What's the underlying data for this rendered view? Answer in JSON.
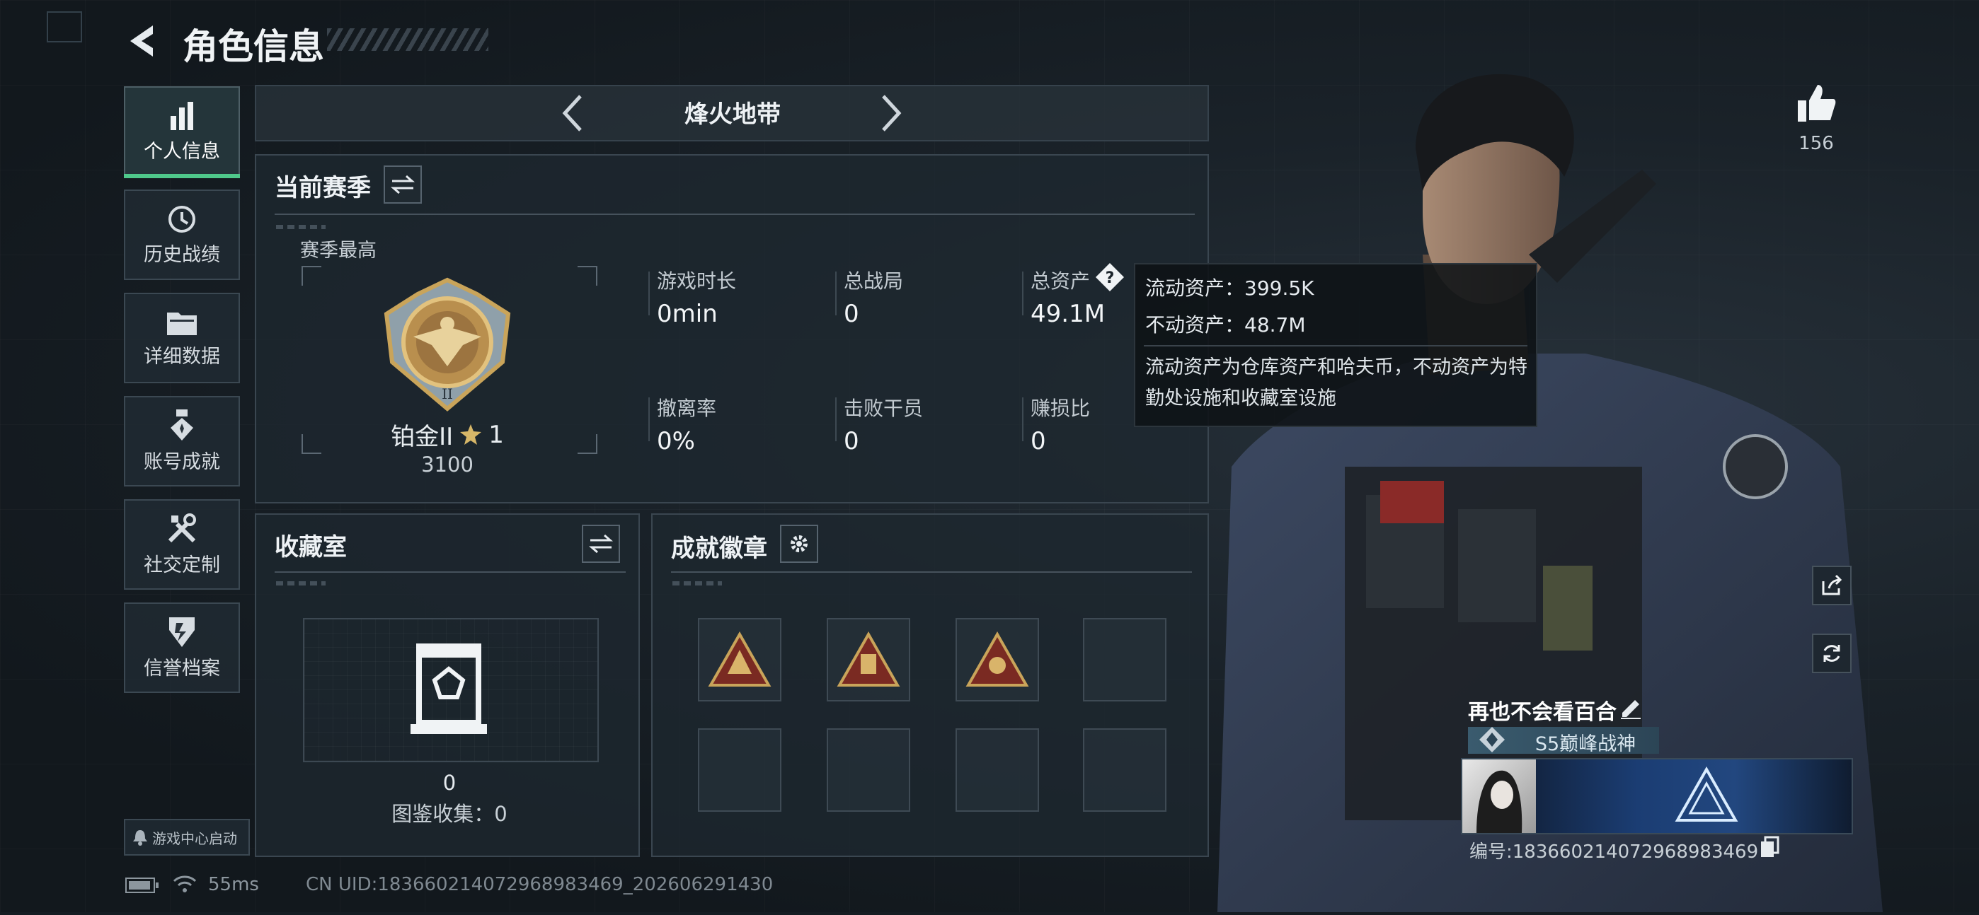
{
  "header": {
    "title": "角色信息"
  },
  "sidebar": {
    "items": [
      {
        "label": "个人信息",
        "icon": "bar-chart-icon",
        "active": true
      },
      {
        "label": "历史战绩",
        "icon": "history-clock-icon"
      },
      {
        "label": "详细数据",
        "icon": "folder-icon"
      },
      {
        "label": "账号成就",
        "icon": "medal-icon"
      },
      {
        "label": "社交定制",
        "icon": "tools-icon"
      },
      {
        "label": "信誉档案",
        "icon": "shield-icon"
      }
    ],
    "game_center_label": "游戏中心启动"
  },
  "mode_selector": {
    "label": "烽火地带"
  },
  "season": {
    "title": "当前赛季",
    "best_label": "赛季最高",
    "rank_name": "铂金II",
    "rank_stars": "1",
    "rank_score": "3100",
    "stats": [
      {
        "label": "游戏时长",
        "value": "0min"
      },
      {
        "label": "总战局",
        "value": "0"
      },
      {
        "label": "总资产",
        "value": "49.1M"
      },
      {
        "label": "撤离率",
        "value": "0%"
      },
      {
        "label": "击败干员",
        "value": "0"
      },
      {
        "label": "赚损比",
        "value": "0"
      }
    ]
  },
  "tooltip": {
    "liquid": "流动资产：399.5K",
    "fixed": "不动资产：48.7M",
    "desc": "流动资产为仓库资产和哈夫币，不动资产为特勤处设施和收藏室设施"
  },
  "collection": {
    "title": "收藏室",
    "count": "0",
    "catalog": "图鉴收集：0"
  },
  "achievements": {
    "title": "成就徽章"
  },
  "likes": {
    "count": "156"
  },
  "player": {
    "name": "再也不会看百合",
    "title_badge": "S5巅峰战神",
    "id_label": "编号:1836602140729689834​69"
  },
  "status_bar": {
    "ping": "55ms",
    "uid": "CN UID:1836602140729689834​69_202606291430"
  },
  "colors": {
    "accent_green": "#4fc98b",
    "gold": "#c9a45a",
    "panel_border": "#3a4650"
  }
}
